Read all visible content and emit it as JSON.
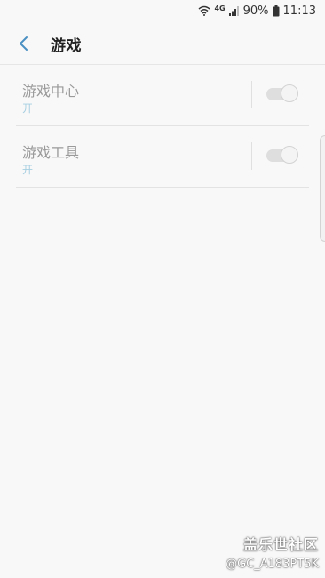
{
  "status_bar": {
    "network_type": "4G",
    "battery_percent": "90%",
    "time": "11:13"
  },
  "app_bar": {
    "title": "游戏"
  },
  "settings": {
    "items": [
      {
        "title": "游戏中心",
        "status": "开",
        "enabled": true
      },
      {
        "title": "游戏工具",
        "status": "开",
        "enabled": true
      }
    ]
  },
  "watermark": {
    "site": "盖乐世社区",
    "user": "@GC_A183PT5K"
  },
  "colors": {
    "background": "#f8f8f8",
    "accent": "#4a90c2",
    "status_text": "#a6cfe1",
    "disabled_text": "#9a9a9a"
  }
}
